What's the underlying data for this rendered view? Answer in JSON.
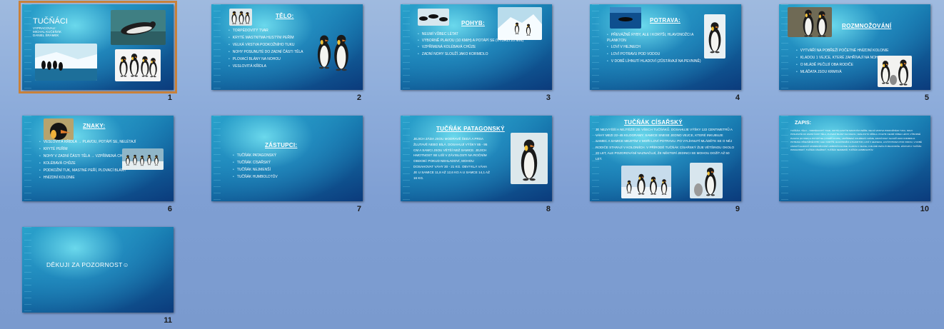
{
  "slides": {
    "s1": {
      "num": "1",
      "title": "Tučňáci",
      "sub1": "Vypracovali:",
      "sub2": "Michal Kučeňák",
      "sub3": "Daniel Šrámek"
    },
    "s2": {
      "num": "2",
      "title": "Tělo:",
      "items": [
        "Torpédovitý tvar",
        "Kryté mastnýma hustým peřím",
        "Velká vrstva podkožního tuku",
        "Nohy posunuté do zadní části těla",
        "Plovací blány na nohou",
        "Veslovitá křídla"
      ]
    },
    "s3": {
      "num": "3",
      "title": "Pohyb:",
      "items": [
        "Neumí vůbec létat",
        "Výborně plavou (10 km/h) a potápí se (vydrží 20 min)",
        "Vzpřímená kolébavá chůze",
        "Zadní nohy slouží jako kormidlo"
      ]
    },
    "s4": {
      "num": "4",
      "title": "Potrava:",
      "items": [
        "Převážně ryby, ale i korýši, hlavonožci a plankton",
        "Loví v hejnech",
        "Loví potravu pod vodou",
        "V době líhnutí hladoví (zůstávají na pevnině)"
      ]
    },
    "s5": {
      "num": "5",
      "title": "Rozmnožování",
      "items": [
        "Vytváří na pobřeží početné hnízdní kolonie",
        "Kladou 1 vejce, které zahřívají na nohou",
        "O mládě pečují oba rodiče",
        "Mláďata jsou krmivá"
      ]
    },
    "s6": {
      "num": "6",
      "title": "Znaky:",
      "items": [
        "Veslovitá křídla → plavou, potápí se, nelétají",
        "Kryté peřím",
        "Nohy v zadní části těla → vzpřímená chůze",
        "Kolébavá chůze",
        "Podkožní tuk, mastné peří, plovací blány",
        "Hnízdní kolonie"
      ]
    },
    "s7": {
      "num": "7",
      "title": "Zástupci:",
      "items": [
        "Tučňák patagonský",
        "Tučňák císařský",
        "Tučňák nejmenší",
        "Tučňák humboldtův"
      ]
    },
    "s8": {
      "num": "8",
      "title": "Tučňák patagonský",
      "text": "Jejich záda jsou modravě šedá a prsa žlutavě nebo bílá. Dosahují výšky 85 - 95 cm a samci jsou větší než samice. Jejich hmotnost se liší v závislosti na ročním období: pokud nehladoví, mohou dosahovat váhy 30 - 21 kg. Obvyklá váha je u samice 11,8 až 12,6 kg a u samce 14,1 až 16 kg."
    },
    "s9": {
      "num": "9",
      "title": "Tučňák císařský",
      "text": "Je nejvyšší a nejtěžší ze všech tučňáků. Dosahuje výšky 122 centimetrů a váhy mezi 22–45 kilogramy. Samice snese jedno vejce, které inkubuje samec a samice mezitím v moři loví potravu. Po vylíhnutí mláděte se o něj rodiče starají v koloniích. V přírodě tučňák císařský žije většinou okolo 20 let, ale pozorování naznačují, že některí jedinci se mohou dožít až 50 let."
    },
    "s10": {
      "num": "10",
      "title": "Zapis:",
      "text": "Tučňáci: Tělo – torpédovitý tvar, kryté hustým mastným peřím, velká vrstva podkožního tuku, nohy posunuté do zadní části těla, plovací blány na nohou, veslovitá křídla. Pohyb: neumí vůbec létat, výborně plavou (10 km/h) a potápí se (vydrží 20 min), vzpřímená kolébavá chůze, zadní nohy slouží jako kormidlo. Potrava: převážně ryby, ale i korýši, hlavonožci a plankton, loví v hejnech, loví potravu pod vodou, v době líhnutí hladoví. Rozmnožování: hnízdní kolonie, kladou 1 vejce, o mládě pečují oba rodiče. Zástupci: tučňák patagonský, tučňák císařský, tučňák nejmenší, tučňák humboldtův."
    },
    "s11": {
      "num": "11",
      "title": "Děkuji za pozornost☺"
    }
  },
  "colors": {
    "selection": "#c8813a",
    "text": "#ffffff"
  },
  "icons": [
    "penguin-photo",
    "iceberg-photo",
    "ocean-photo",
    "chick-photo"
  ]
}
